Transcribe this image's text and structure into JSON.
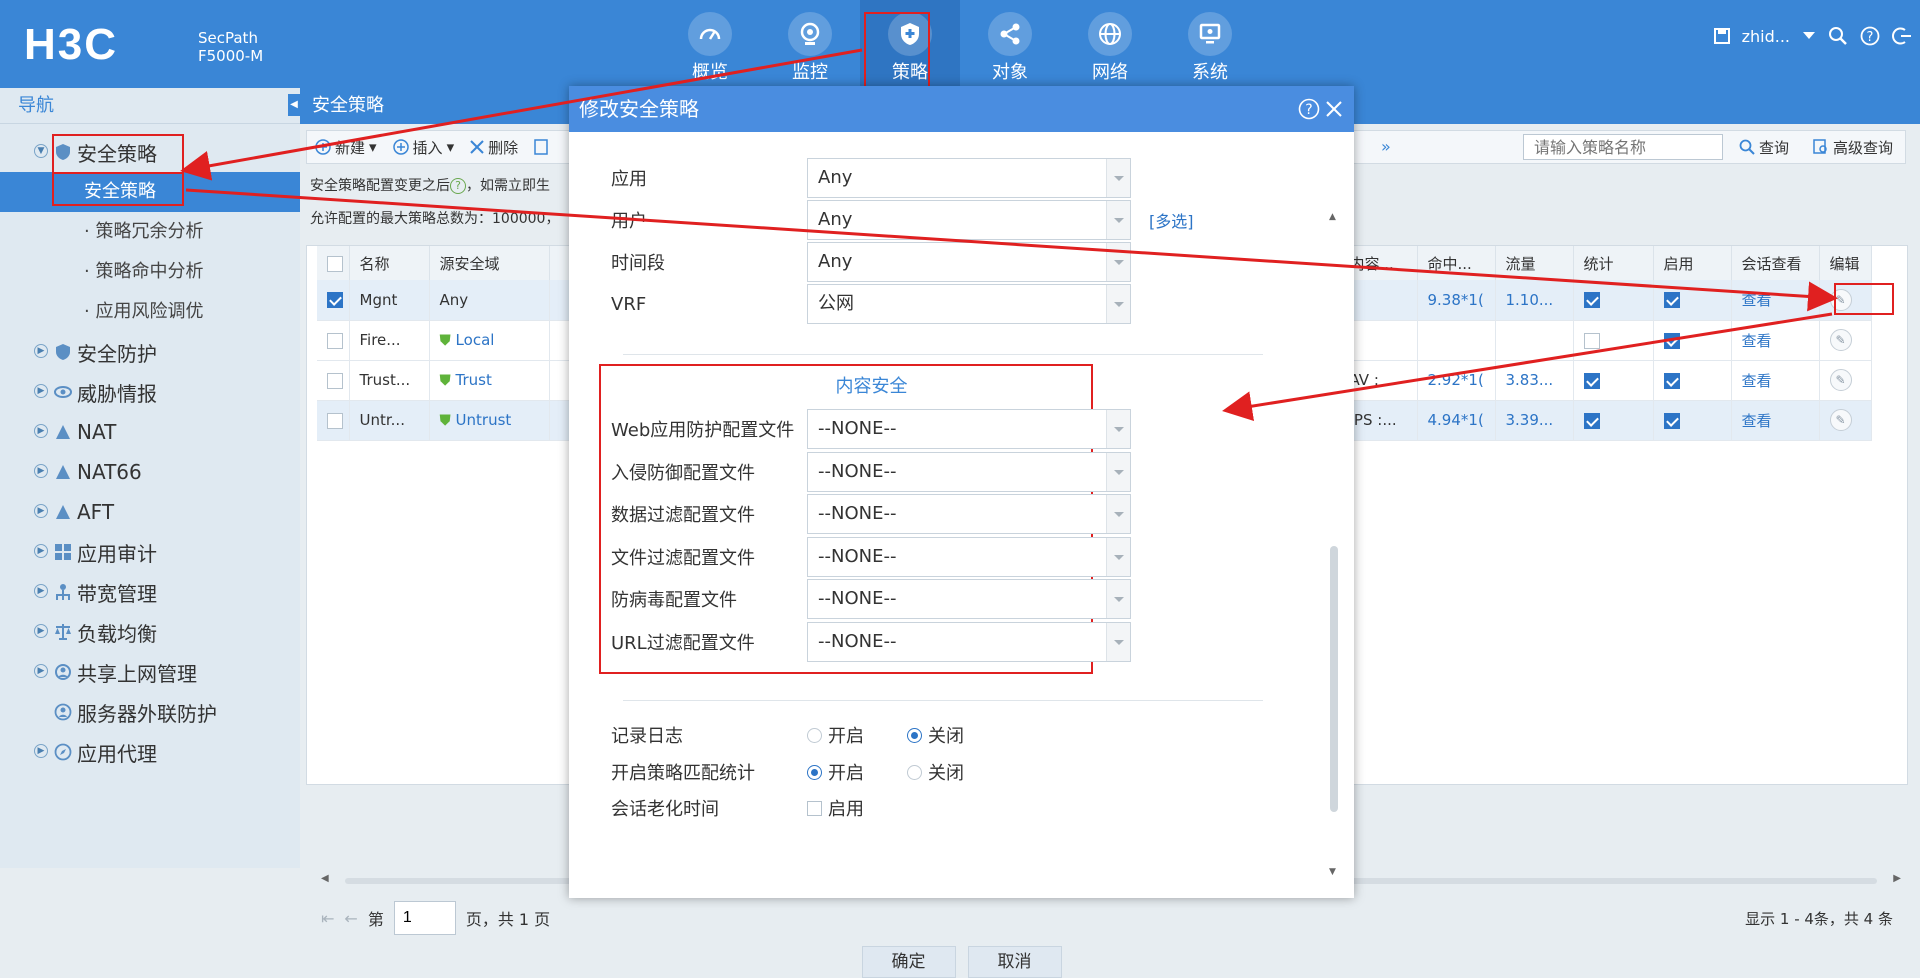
{
  "header": {
    "brand": "H3C",
    "product_line1": "SecPath",
    "product_line2": "F5000-M",
    "nav": [
      {
        "label": "概览",
        "icon": "gauge-icon"
      },
      {
        "label": "监控",
        "icon": "camera-icon"
      },
      {
        "label": "策略",
        "icon": "shield-icon"
      },
      {
        "label": "对象",
        "icon": "share-icon"
      },
      {
        "label": "网络",
        "icon": "globe-icon"
      },
      {
        "label": "系统",
        "icon": "monitor-icon"
      }
    ],
    "user": "zhid..."
  },
  "sidebar": {
    "title": "导航",
    "items": [
      {
        "label": "安全策略"
      },
      {
        "label": "安全防护"
      },
      {
        "label": "威胁情报"
      },
      {
        "label": "NAT"
      },
      {
        "label": "NAT66"
      },
      {
        "label": "AFT"
      },
      {
        "label": "应用审计"
      },
      {
        "label": "带宽管理"
      },
      {
        "label": "负载均衡"
      },
      {
        "label": "共享上网管理"
      },
      {
        "label": "服务器外联防护"
      },
      {
        "label": "应用代理"
      }
    ],
    "subitems": [
      "安全策略",
      "策略冗余分析",
      "策略命中分析",
      "应用风险调优"
    ]
  },
  "main": {
    "tab": "安全策略",
    "toolbar": {
      "new": "新建",
      "insert": "插入",
      "delete": "删除",
      "more": "»",
      "search_placeholder": "请输入策略名称",
      "query": "查询",
      "advanced": "高级查询"
    },
    "note1": "安全策略配置变更之后",
    "note1_tail": "，如需立即生",
    "note2": "允许配置的最大策略总数为：100000，",
    "columns_left": [
      "名称",
      "源安全域"
    ],
    "columns_right": [
      "内容...",
      "命中...",
      "流量",
      "统计",
      "启用",
      "会话查看",
      "编辑"
    ],
    "rows": [
      {
        "name": "Mgnt",
        "zone": "Any",
        "content": "",
        "hits": "9.38*1(",
        "traffic": "1.10...",
        "stat": true,
        "enabled": true,
        "view": "查看",
        "checked": true
      },
      {
        "name": "Fire...",
        "zone": "Local",
        "content": "",
        "hits": "",
        "traffic": "",
        "stat": false,
        "enabled": true,
        "view": "查看",
        "checked": false
      },
      {
        "name": "Trust...",
        "zone": "Trust",
        "content": "AV :",
        "hits": "2.92*1(",
        "traffic": "3.83...",
        "stat": true,
        "enabled": true,
        "view": "查看",
        "checked": false
      },
      {
        "name": "Untr...",
        "zone": "Untrust",
        "content": "IPS :...",
        "hits": "4.94*1(",
        "traffic": "3.39...",
        "stat": true,
        "enabled": true,
        "view": "查看",
        "checked": false
      }
    ],
    "pager": {
      "prefix": "第",
      "page": "1",
      "suffix": "页，共 1 页",
      "summary": "显示 1 - 4条，共 4 条"
    }
  },
  "modal": {
    "title": "修改安全策略",
    "fields_top": [
      {
        "label": "应用",
        "value": "Any"
      },
      {
        "label": "用户",
        "value": "Any"
      },
      {
        "label": "时间段",
        "value": "Any"
      },
      {
        "label": "VRF",
        "value": "公网"
      }
    ],
    "multi_link": "[多选]",
    "section_title": "内容安全",
    "fields_content": [
      {
        "label": "Web应用防护配置文件",
        "value": "--NONE--"
      },
      {
        "label": "入侵防御配置文件",
        "value": "--NONE--"
      },
      {
        "label": "数据过滤配置文件",
        "value": "--NONE--"
      },
      {
        "label": "文件过滤配置文件",
        "value": "--NONE--"
      },
      {
        "label": "防病毒配置文件",
        "value": "--NONE--"
      },
      {
        "label": "URL过滤配置文件",
        "value": "--NONE--"
      }
    ],
    "log_label": "记录日志",
    "stat_label": "开启策略匹配统计",
    "aging_label": "会话老化时间",
    "on": "开启",
    "off": "关闭",
    "enable": "启用",
    "ok": "确定",
    "cancel": "取消"
  },
  "colors": {
    "header": "#3a86d6",
    "annotation": "#e02020",
    "link": "#2c74c6"
  }
}
